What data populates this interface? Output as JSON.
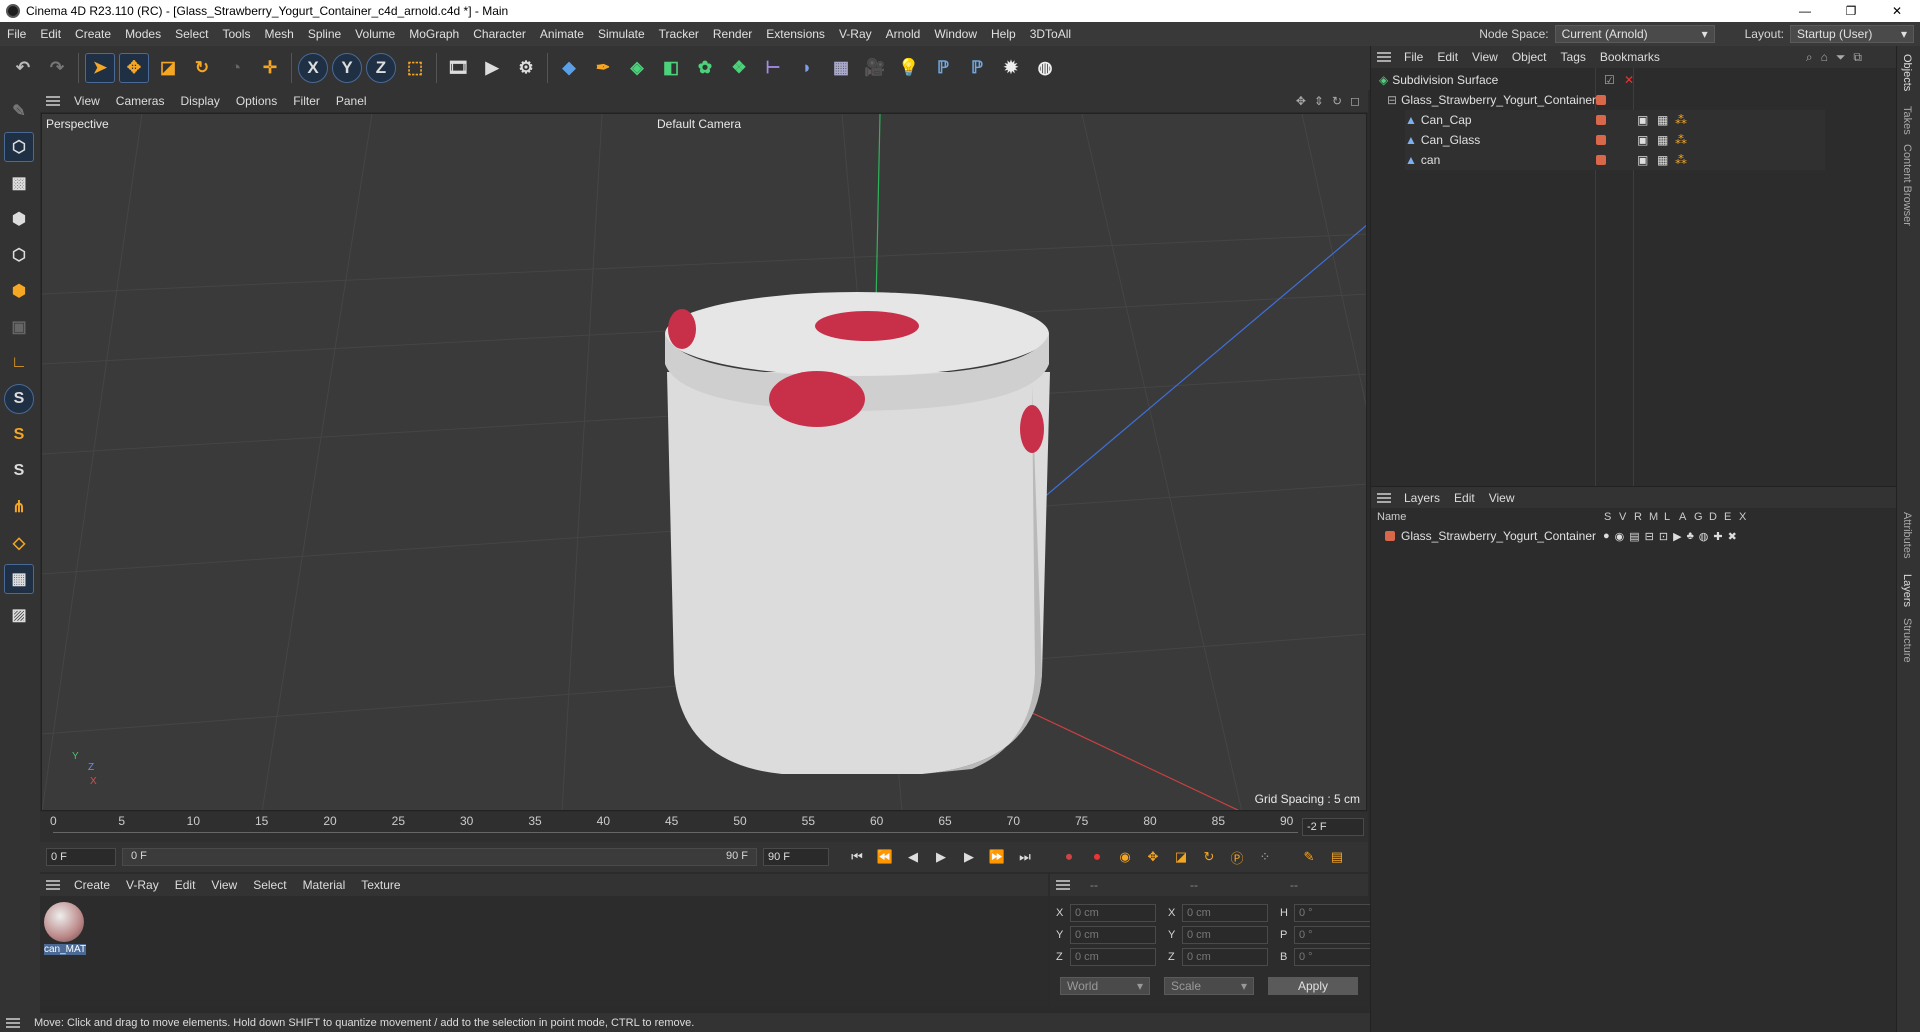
{
  "window": {
    "title": "Cinema 4D R23.110 (RC) - [Glass_Strawberry_Yogurt_Container_c4d_arnold.c4d *] - Main",
    "controls": [
      "—",
      "❐",
      "✕"
    ]
  },
  "menubar": {
    "items": [
      "File",
      "Edit",
      "Create",
      "Modes",
      "Select",
      "Tools",
      "Mesh",
      "Spline",
      "Volume",
      "MoGraph",
      "Character",
      "Animate",
      "Simulate",
      "Tracker",
      "Render",
      "Extensions",
      "V-Ray",
      "Arnold",
      "Window",
      "Help",
      "3DToAll"
    ],
    "node_space_label": "Node Space:",
    "node_space_value": "Current (Arnold)",
    "layout_label": "Layout:",
    "layout_value": "Startup (User)"
  },
  "toolbar": {
    "icons": [
      "undo-icon",
      "redo-icon",
      "select-icon",
      "move-icon",
      "scale-icon",
      "rotate-icon",
      "recent-icon",
      "transform-icon",
      "x-axis-icon",
      "y-axis-icon",
      "z-axis-icon",
      "coord-system-icon",
      "render-region-icon",
      "render-view-icon",
      "render-settings-icon",
      "cube-icon",
      "pen-icon",
      "subdivision-icon",
      "extrude-icon",
      "cloner-icon",
      "array-icon",
      "symmetry-icon",
      "deformer-icon",
      "floor-icon",
      "camera-icon",
      "light-icon",
      "python-icon",
      "python2-icon",
      "gear-icon",
      "globe-icon"
    ],
    "axis_labels": [
      "X",
      "Y",
      "Z"
    ]
  },
  "viewport": {
    "menu": [
      "View",
      "Cameras",
      "Display",
      "Options",
      "Filter",
      "Panel"
    ],
    "view_name": "Perspective",
    "camera": "Default Camera",
    "grid_spacing": "Grid Spacing : 5 cm",
    "axis": {
      "y": "Y",
      "z": "Z",
      "x": "X"
    }
  },
  "timeline": {
    "ticks": [
      "0",
      "5",
      "10",
      "15",
      "20",
      "25",
      "30",
      "35",
      "40",
      "45",
      "50",
      "55",
      "60",
      "65",
      "70",
      "75",
      "80",
      "85",
      "90"
    ],
    "current_frame": "-2 F",
    "start": "0 F",
    "range_start": "0 F",
    "range_end": "90 F",
    "end": "90 F"
  },
  "material_manager": {
    "menu": [
      "Create",
      "V-Ray",
      "Edit",
      "View",
      "Select",
      "Material",
      "Texture"
    ],
    "materials": [
      {
        "name": "can_MAT"
      }
    ]
  },
  "coordinates": {
    "header": [
      "--",
      "--",
      "--"
    ],
    "rows": [
      {
        "a": "X",
        "av": "0 cm",
        "b": "X",
        "bv": "0 cm",
        "c": "H",
        "cv": "0 °"
      },
      {
        "a": "Y",
        "av": "0 cm",
        "b": "Y",
        "bv": "0 cm",
        "c": "P",
        "cv": "0 °"
      },
      {
        "a": "Z",
        "av": "0 cm",
        "b": "Z",
        "bv": "0 cm",
        "c": "B",
        "cv": "0 °"
      }
    ],
    "space": "World",
    "mode": "Scale",
    "apply": "Apply"
  },
  "objects_panel": {
    "menu": [
      "File",
      "Edit",
      "View",
      "Object",
      "Tags",
      "Bookmarks"
    ],
    "items": [
      {
        "name": "Subdivision Surface",
        "indent": 0
      },
      {
        "name": "Glass_Strawberry_Yogurt_Container",
        "indent": 1
      },
      {
        "name": "Can_Cap",
        "indent": 2
      },
      {
        "name": "Can_Glass",
        "indent": 2
      },
      {
        "name": "can",
        "indent": 2
      }
    ]
  },
  "layers_panel": {
    "menu": [
      "Layers",
      "Edit",
      "View"
    ],
    "columns": [
      "Name",
      "S",
      "V",
      "R",
      "M",
      "L",
      "A",
      "G",
      "D",
      "E",
      "X"
    ],
    "items": [
      {
        "name": "Glass_Strawberry_Yogurt_Container"
      }
    ]
  },
  "side_tabs": [
    "Objects",
    "Takes",
    "Content Browser",
    "Attributes",
    "Layers",
    "Structure"
  ],
  "status": "Move: Click and drag to move elements. Hold down SHIFT to quantize movement / add to the selection in point mode, CTRL to remove.",
  "colors": {
    "accent": "#f5a623",
    "layer": "#d9674a",
    "selected": "#4a6a95"
  }
}
